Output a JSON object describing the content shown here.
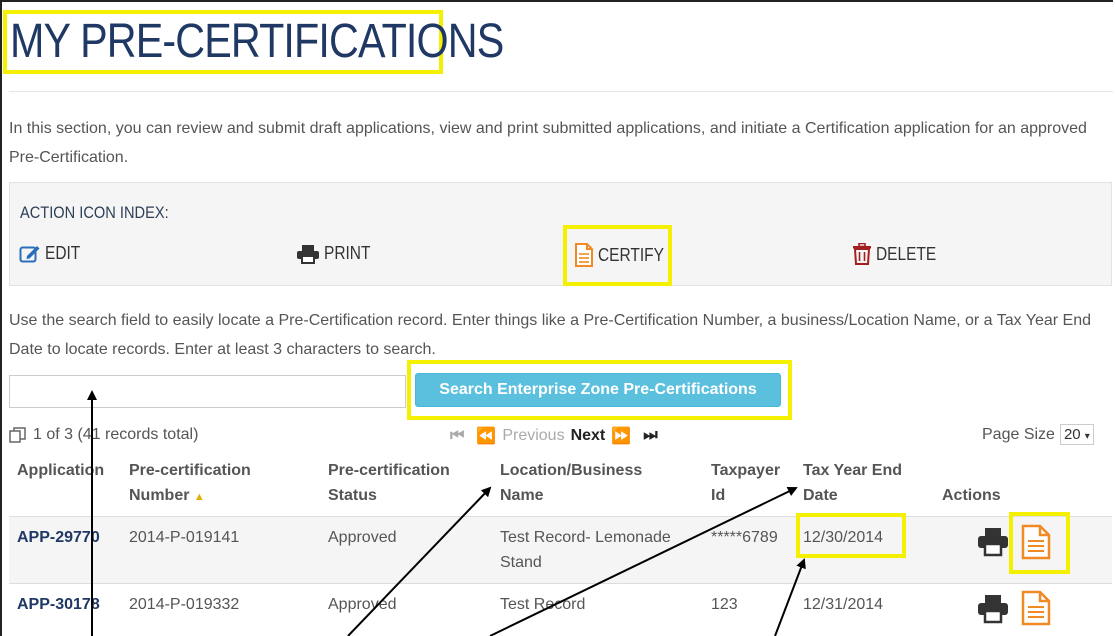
{
  "page": {
    "title": "MY PRE-CERTIFICATIONS",
    "intro": "In this section, you can review and submit draft applications, view and print submitted applications, and initiate a Certification application for an approved Pre-Certification."
  },
  "action_index": {
    "title": "ACTION ICON INDEX:",
    "items": [
      {
        "label": "EDIT",
        "icon": "edit-icon",
        "color": "#2a6ebb"
      },
      {
        "label": "PRINT",
        "icon": "print-icon",
        "color": "#333333"
      },
      {
        "label": "CERTIFY",
        "icon": "certify-icon",
        "color": "#f08a24"
      },
      {
        "label": "DELETE",
        "icon": "trash-icon",
        "color": "#a31f1f"
      }
    ]
  },
  "search": {
    "help": "Use the search field to easily locate a Pre-Certification record. Enter things like a Pre-Certification Number, a business/Location Name, or a Tax Year End Date to locate records. Enter at least 3 characters to search.",
    "value": "",
    "button_label": "Search Enterprise Zone Pre-Certifications"
  },
  "pager": {
    "info": "1 of 3 (41 records total)",
    "previous": "Previous",
    "next": "Next",
    "page_size_label": "Page Size",
    "page_size": "20"
  },
  "table": {
    "headers": {
      "application": "Application",
      "number_1": "Pre-certification",
      "number_2": "Number",
      "status_1": "Pre-certification",
      "status_2": "Status",
      "location_1": "Location/Business",
      "location_2": "Name",
      "taxpayer_1": "Taxpayer",
      "taxpayer_2": "Id",
      "taxyear_1": "Tax Year End",
      "taxyear_2": "Date",
      "actions": "Actions"
    },
    "rows": [
      {
        "application": "APP-29770",
        "number": "2014-P-019141",
        "status": "Approved",
        "location_1": "Test Record- Lemonade",
        "location_2": "Stand",
        "taxpayer": "*****6789",
        "tax_year_end": "12/30/2014"
      },
      {
        "application": "APP-30178",
        "number": "2014-P-019332",
        "status": "Approved",
        "location_1": "Test Record",
        "location_2": "",
        "taxpayer": "123",
        "tax_year_end": "12/31/2014"
      }
    ]
  },
  "colors": {
    "highlight": "#f5f000",
    "title": "#1f3864",
    "button": "#5bc0de",
    "certify": "#f08a24"
  }
}
